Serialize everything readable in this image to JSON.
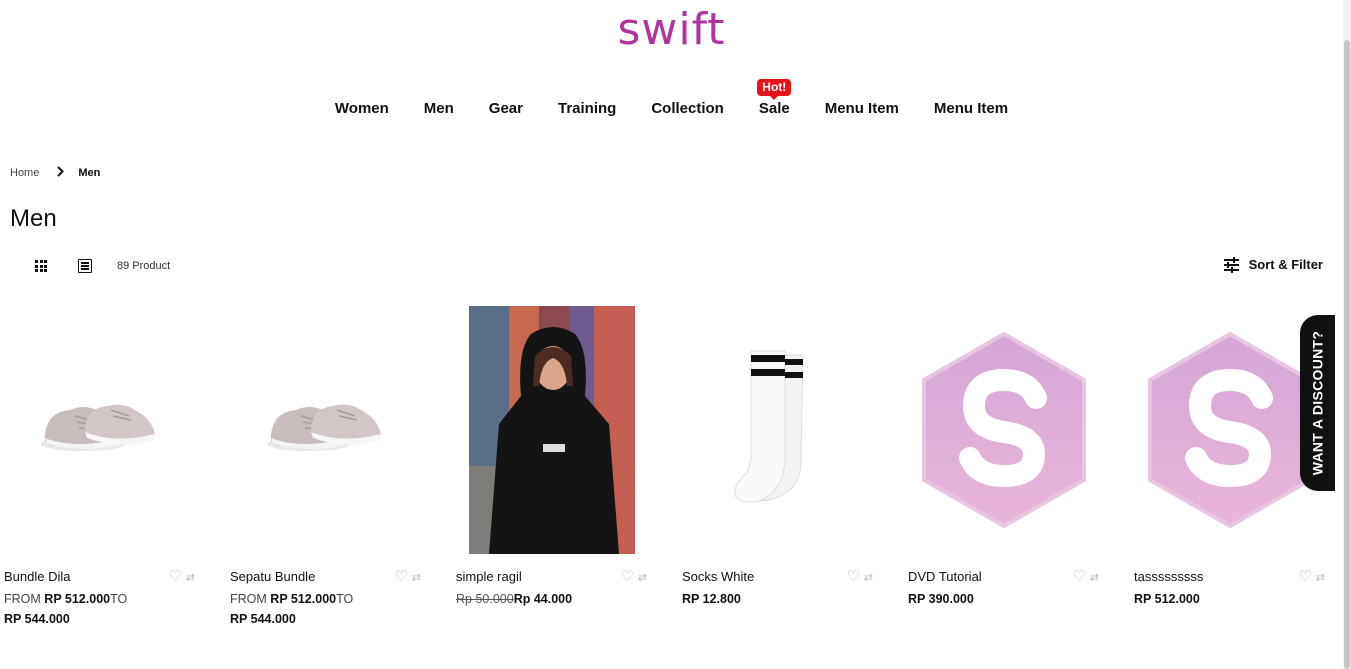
{
  "brand": {
    "logo_text": "swift",
    "color": "#b1339e"
  },
  "nav": {
    "items": [
      {
        "label": "Women"
      },
      {
        "label": "Men"
      },
      {
        "label": "Gear"
      },
      {
        "label": "Training"
      },
      {
        "label": "Collection"
      },
      {
        "label": "Sale",
        "badge": "Hot!"
      },
      {
        "label": "Menu Item"
      },
      {
        "label": "Menu Item"
      }
    ],
    "badge_color": "#e5141b"
  },
  "breadcrumb": {
    "home": "Home",
    "current": "Men"
  },
  "page_title": "Men",
  "toolbar": {
    "product_count": "89 Product",
    "sort_filter": "Sort & Filter"
  },
  "products": [
    {
      "name": "Bundle Dila",
      "from_label": "FROM",
      "price_from": "RP 512.000",
      "to_label": "TO",
      "price_to": "RP 544.000",
      "image": "sneaker"
    },
    {
      "name": "Sepatu Bundle",
      "from_label": "FROM",
      "price_from": "RP 512.000",
      "to_label": "TO",
      "price_to": "RP 544.000",
      "image": "sneaker"
    },
    {
      "name": "simple ragil",
      "old_price": "Rp 50.000",
      "price": "Rp 44.000",
      "image": "hoodie-photo"
    },
    {
      "name": "Socks White",
      "price": "RP 12.800",
      "image": "socks"
    },
    {
      "name": "DVD Tutorial",
      "price": "RP 390.000",
      "image": "swift-logo-placeholder"
    },
    {
      "name": "tasssssssss",
      "price": "RP 512.000",
      "image": "swift-logo-placeholder"
    }
  ],
  "discount_tab": {
    "label": "WANT A DISCOUNT?"
  },
  "icons": {
    "grid_view": "grid-icon",
    "list_view": "list-icon",
    "sort": "sliders-icon",
    "wishlist": "heart-icon",
    "compare": "compare-icon",
    "breadcrumb_sep": "chevron-right-icon"
  }
}
